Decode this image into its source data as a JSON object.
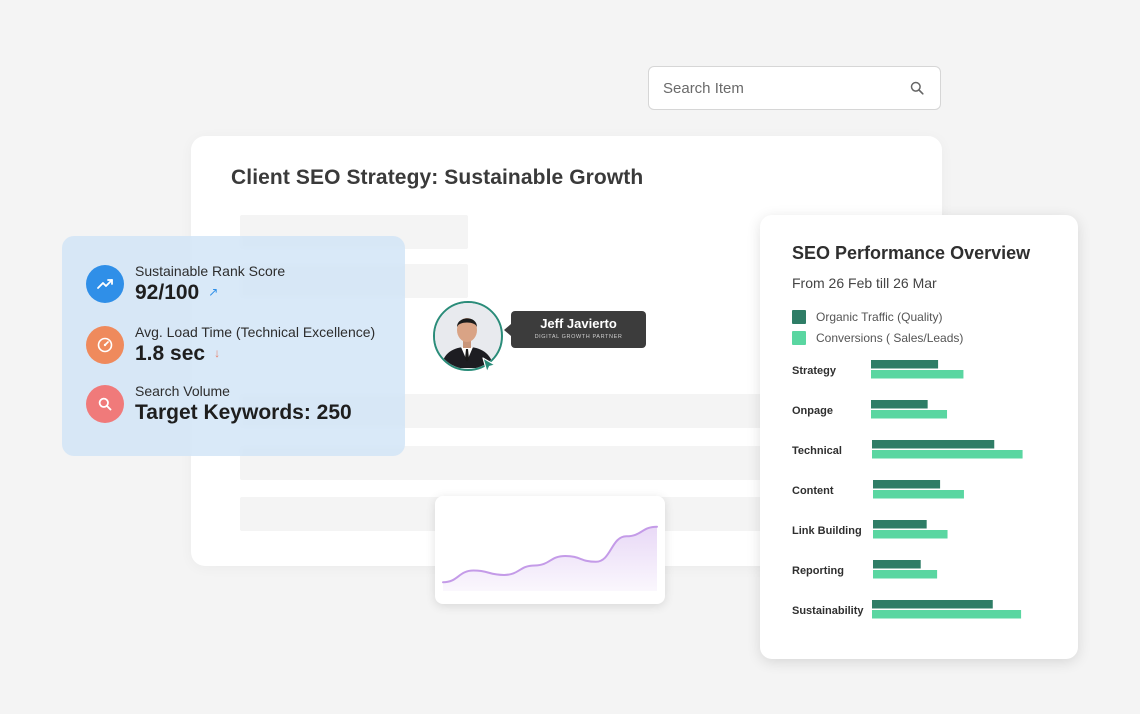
{
  "search": {
    "placeholder": "Search Item"
  },
  "main": {
    "title": "Client SEO Strategy: Sustainable Growth"
  },
  "metrics": [
    {
      "label": "Sustainable Rank Score",
      "value": "92/100",
      "arrow": "↗",
      "icon": "trending-up-icon",
      "color": "#2f8fe8",
      "arrow_color": "#2f8fe8"
    },
    {
      "label": "Avg. Load Time (Technical Excellence)",
      "value": "1.8 sec",
      "arrow": "↓",
      "icon": "speedometer-icon",
      "color": "#ef8a5c",
      "arrow_color": "#e8806b"
    },
    {
      "label": "Search Volume",
      "value": "Target Keywords: 250",
      "arrow": "",
      "icon": "search-icon",
      "color": "#f07a7a",
      "arrow_color": ""
    }
  ],
  "person": {
    "name": "Jeff Javierto",
    "role": "DIGITAL GROWTH PARTNER"
  },
  "trend_chart": {
    "type": "area",
    "values": [
      12,
      28,
      22,
      35,
      48,
      40,
      75,
      88
    ],
    "color": "#c49be8"
  },
  "chart_data": {
    "type": "bar",
    "title": "SEO Performance Overview",
    "subtitle": "From 26 Feb till 26 Mar",
    "categories": [
      "Strategy",
      "Onpage",
      "Technical",
      "Content",
      "Link Building",
      "Reporting",
      "Sustainability"
    ],
    "series": [
      {
        "name": "Organic Traffic (Quality)",
        "color": "#2e7d66",
        "values": [
          45,
          38,
          82,
          45,
          36,
          32,
          81
        ]
      },
      {
        "name": "Conversions ( Sales/Leads)",
        "color": "#5ad6a1",
        "values": [
          62,
          51,
          101,
          61,
          50,
          43,
          100
        ]
      }
    ],
    "xlim": [
      0,
      110
    ],
    "grid": false,
    "legend": "top-left"
  }
}
